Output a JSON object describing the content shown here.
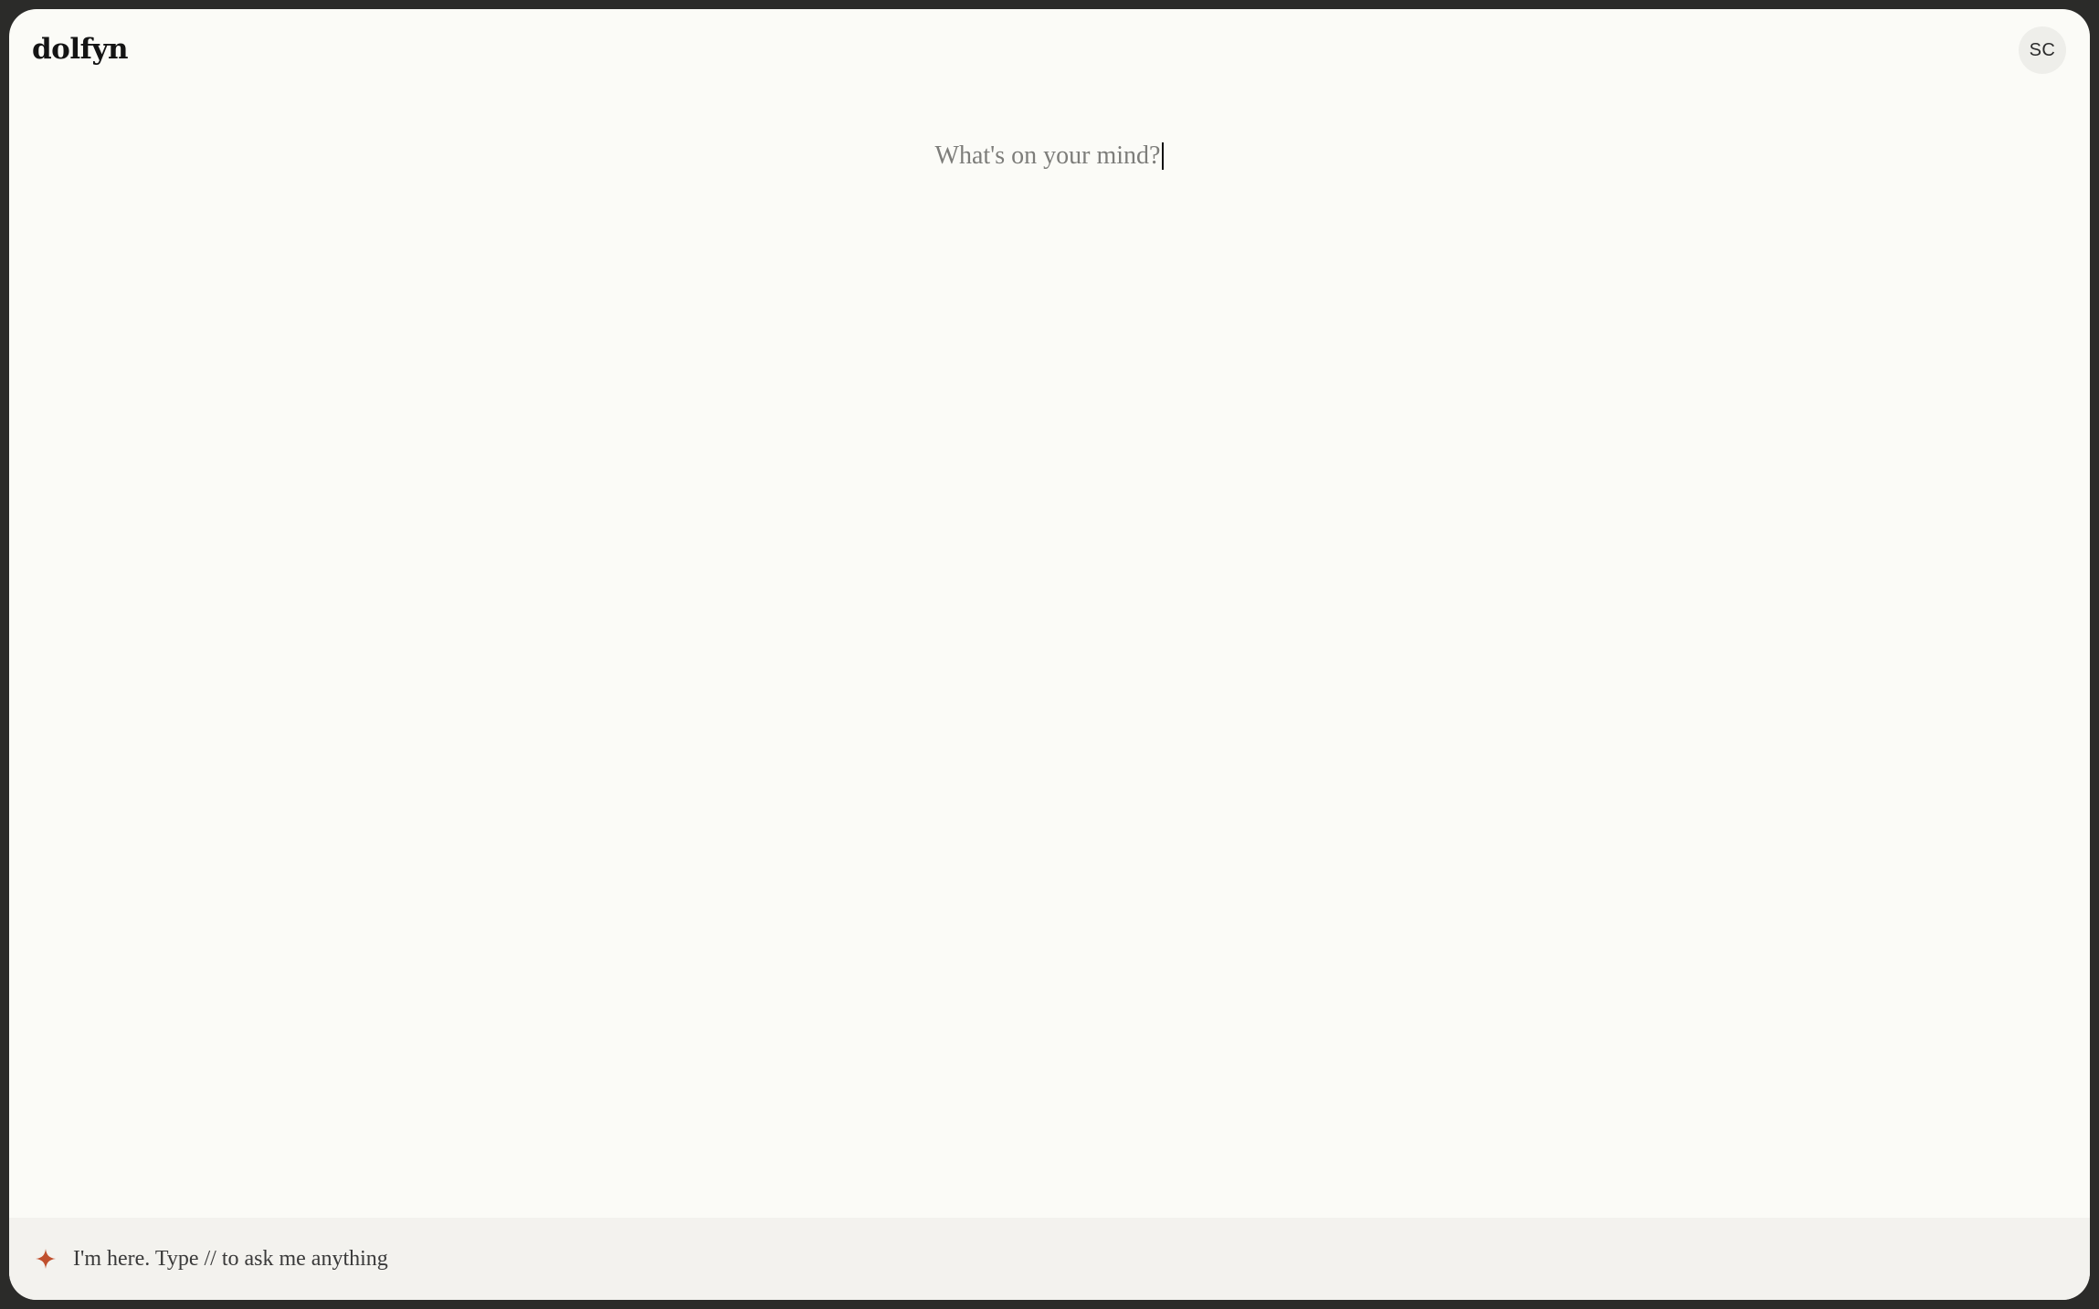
{
  "app": {
    "brand": "dolfyn",
    "user_initials": "SC"
  },
  "editor": {
    "placeholder": "What's on your mind?",
    "value": ""
  },
  "assistant_bar": {
    "icon": "sparkle-icon",
    "placeholder": "I'm here. Type // to ask me anything",
    "icon_color": "#c0502e"
  },
  "colors": {
    "background": "#fbfbf7",
    "frame": "#2b2b29",
    "footer": "#f3f2ee",
    "accent": "#c0502e"
  }
}
